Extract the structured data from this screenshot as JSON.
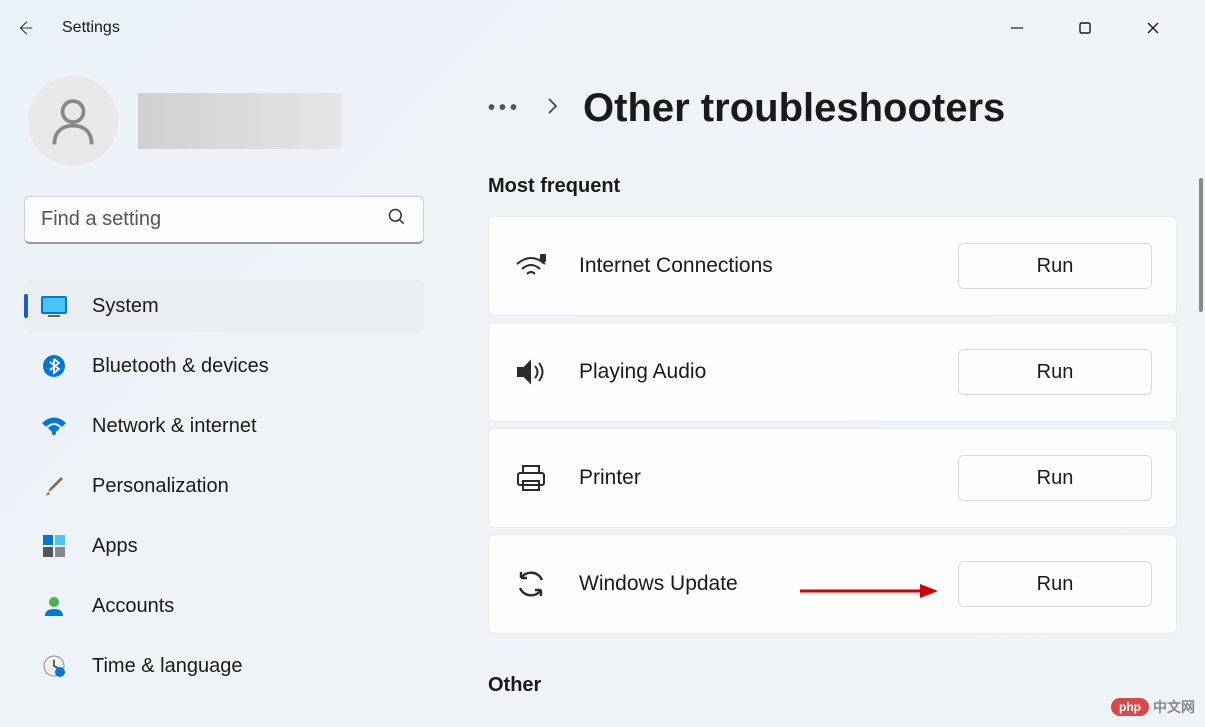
{
  "app": {
    "title": "Settings"
  },
  "search": {
    "placeholder": "Find a setting"
  },
  "sidebar": {
    "items": [
      {
        "label": "System",
        "active": true
      },
      {
        "label": "Bluetooth & devices",
        "active": false
      },
      {
        "label": "Network & internet",
        "active": false
      },
      {
        "label": "Personalization",
        "active": false
      },
      {
        "label": "Apps",
        "active": false
      },
      {
        "label": "Accounts",
        "active": false
      },
      {
        "label": "Time & language",
        "active": false
      }
    ]
  },
  "page": {
    "title": "Other troubleshooters"
  },
  "sections": {
    "most_frequent": "Most frequent",
    "other": "Other"
  },
  "troubleshooters": [
    {
      "label": "Internet Connections",
      "button": "Run"
    },
    {
      "label": "Playing Audio",
      "button": "Run"
    },
    {
      "label": "Printer",
      "button": "Run"
    },
    {
      "label": "Windows Update",
      "button": "Run"
    }
  ],
  "watermark": {
    "badge": "php",
    "text": "中文网"
  }
}
